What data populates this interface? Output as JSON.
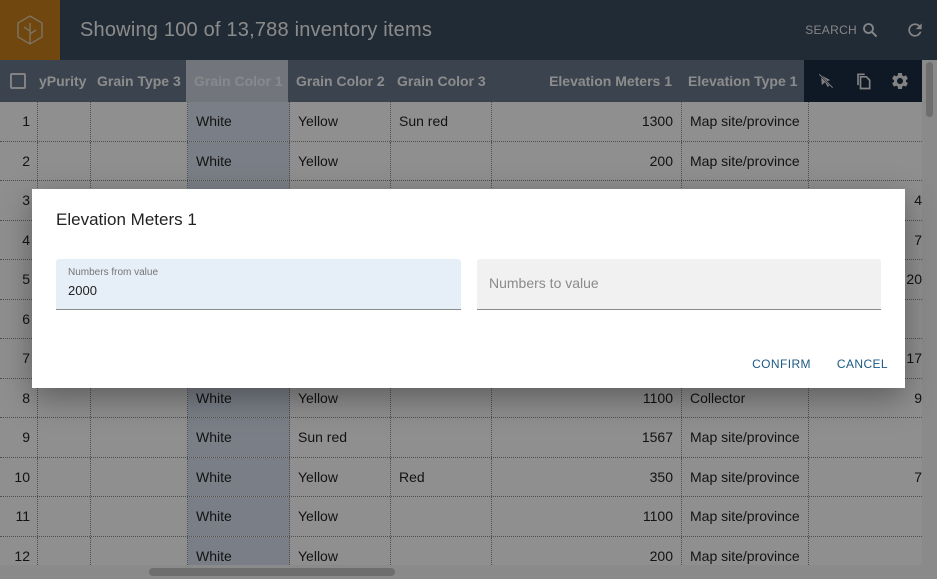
{
  "header": {
    "logo_icon": "tree-icon",
    "title": "Showing 100 of 13,788 inventory items",
    "search_label": "SEARCH",
    "search_icon": "search-icon",
    "refresh_icon": "refresh-icon"
  },
  "table": {
    "columns": [
      {
        "label": "yPurity"
      },
      {
        "label": "Grain Type 3"
      },
      {
        "label": "Grain Color 1",
        "active": true
      },
      {
        "label": "Grain Color 2"
      },
      {
        "label": "Grain Color 3"
      },
      {
        "label": "Elevation Meters 1"
      },
      {
        "label": "Elevation Type 1"
      }
    ],
    "tools": [
      "deselect-pointer-icon",
      "copy-icon",
      "settings-gear-icon"
    ],
    "rows": [
      {
        "n": "1",
        "c1": "",
        "c2": "",
        "c3": "White",
        "c4": "Yellow",
        "c5": "Sun red",
        "c6": "1300",
        "c7": "Map site/province",
        "c8": ""
      },
      {
        "n": "2",
        "c1": "",
        "c2": "",
        "c3": "White",
        "c4": "Yellow",
        "c5": "",
        "c6": "200",
        "c7": "Map site/province",
        "c8": ""
      },
      {
        "n": "3",
        "c1": "",
        "c2": "",
        "c3": "",
        "c4": "",
        "c5": "",
        "c6": "",
        "c7": "",
        "c8": "4"
      },
      {
        "n": "4",
        "c1": "",
        "c2": "",
        "c3": "",
        "c4": "",
        "c5": "",
        "c6": "",
        "c7": "",
        "c8": "7"
      },
      {
        "n": "5",
        "c1": "",
        "c2": "",
        "c3": "",
        "c4": "",
        "c5": "",
        "c6": "",
        "c7": "",
        "c8": "20"
      },
      {
        "n": "6",
        "c1": "",
        "c2": "",
        "c3": "",
        "c4": "",
        "c5": "",
        "c6": "",
        "c7": "",
        "c8": ""
      },
      {
        "n": "7",
        "c1": "",
        "c2": "",
        "c3": "",
        "c4": "",
        "c5": "",
        "c6": "",
        "c7": "",
        "c8": "17"
      },
      {
        "n": "8",
        "c1": "",
        "c2": "",
        "c3": "White",
        "c4": "Yellow",
        "c5": "",
        "c6": "1100",
        "c7": "Collector",
        "c8": "9"
      },
      {
        "n": "9",
        "c1": "",
        "c2": "",
        "c3": "White",
        "c4": "Sun red",
        "c5": "",
        "c6": "1567",
        "c7": "Map site/province",
        "c8": ""
      },
      {
        "n": "10",
        "c1": "",
        "c2": "",
        "c3": "White",
        "c4": "Yellow",
        "c5": "Red",
        "c6": "350",
        "c7": "Map site/province",
        "c8": "7"
      },
      {
        "n": "11",
        "c1": "",
        "c2": "",
        "c3": "White",
        "c4": "Yellow",
        "c5": "",
        "c6": "1100",
        "c7": "Map site/province",
        "c8": ""
      },
      {
        "n": "12",
        "c1": "",
        "c2": "",
        "c3": "White",
        "c4": "Yellow",
        "c5": "",
        "c6": "200",
        "c7": "Map site/province",
        "c8": ""
      }
    ]
  },
  "dialog": {
    "title": "Elevation Meters 1",
    "from_label": "Numbers from value",
    "from_value": "2000",
    "to_placeholder": "Numbers to value",
    "to_value": "",
    "confirm_label": "CONFIRM",
    "cancel_label": "CANCEL"
  },
  "colors": {
    "header_bg": "#3a4a5c",
    "logo_bg": "#c07a1a",
    "accent_button": "#1d5a86",
    "tools_bg": "#1a2b40"
  }
}
